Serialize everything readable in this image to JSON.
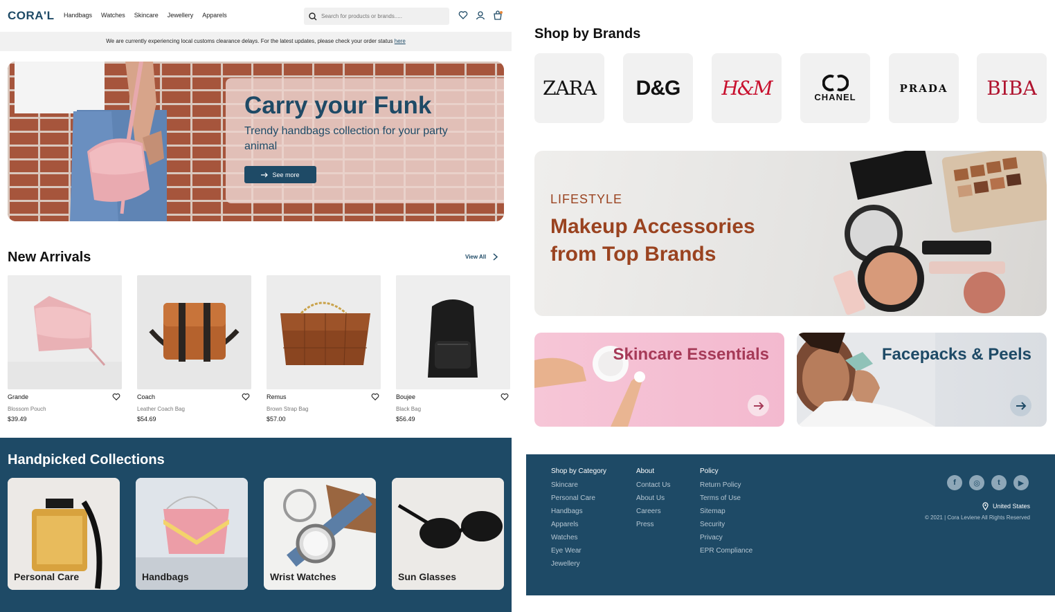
{
  "header": {
    "logo": "CORA'L",
    "nav": [
      "Handbags",
      "Watches",
      "Skincare",
      "Jewellery",
      "Apparels"
    ],
    "search_placeholder": "Search for products or brands....."
  },
  "notice": {
    "text": "We are currently experiencing local customs clearance delays. For the latest updates, please check your order status ",
    "link": "here"
  },
  "hero": {
    "title": "Carry your Funk",
    "subtitle": "Trendy handbags collection for your party animal",
    "button": "See more"
  },
  "new_arrivals": {
    "title": "New Arrivals",
    "view_all": "View All",
    "products": [
      {
        "name": "Grande",
        "desc": "Blossom Pouch",
        "price": "$39.49"
      },
      {
        "name": "Coach",
        "desc": "Leather Coach Bag",
        "price": "$54.69"
      },
      {
        "name": "Remus",
        "desc": "Brown Strap Bag",
        "price": "$57.00"
      },
      {
        "name": "Boujee",
        "desc": "Black Bag",
        "price": "$56.49"
      }
    ]
  },
  "collections": {
    "title": "Handpicked Collections",
    "items": [
      "Personal Care",
      "Handbags",
      "Wrist Watches",
      "Sun Glasses"
    ]
  },
  "brands": {
    "title": "Shop by Brands",
    "items": [
      "ZARA",
      "D&G",
      "H&M",
      "CHANEL",
      "PRADA",
      "BIBA"
    ]
  },
  "lifestyle": {
    "kicker": "LIFESTYLE",
    "title": "Makeup Accessories from Top Brands"
  },
  "promos": {
    "skincare": "Skincare Essentials",
    "facepacks": "Facepacks & Peels"
  },
  "footer": {
    "category": {
      "heading": "Shop by Category",
      "links": [
        "Skincare",
        "Personal Care",
        "Handbags",
        "Apparels",
        "Watches",
        "Eye Wear",
        "Jewellery"
      ]
    },
    "about": {
      "heading": "About",
      "links": [
        "Contact Us",
        "About Us",
        "Careers",
        "Press"
      ]
    },
    "policy": {
      "heading": "Policy",
      "links": [
        "Return Policy",
        "Terms of Use",
        "Sitemap",
        "Security",
        "Privacy",
        "EPR Compliance"
      ]
    },
    "social": [
      "facebook-icon",
      "instagram-icon",
      "twitter-icon",
      "youtube-icon"
    ],
    "country": "United States",
    "copyright": "© 2021 | Cora Leviene All Rights Reserved"
  },
  "colors": {
    "brand": "#1e4a66",
    "accent": "#9a4320",
    "skincare": "#a63a58"
  }
}
